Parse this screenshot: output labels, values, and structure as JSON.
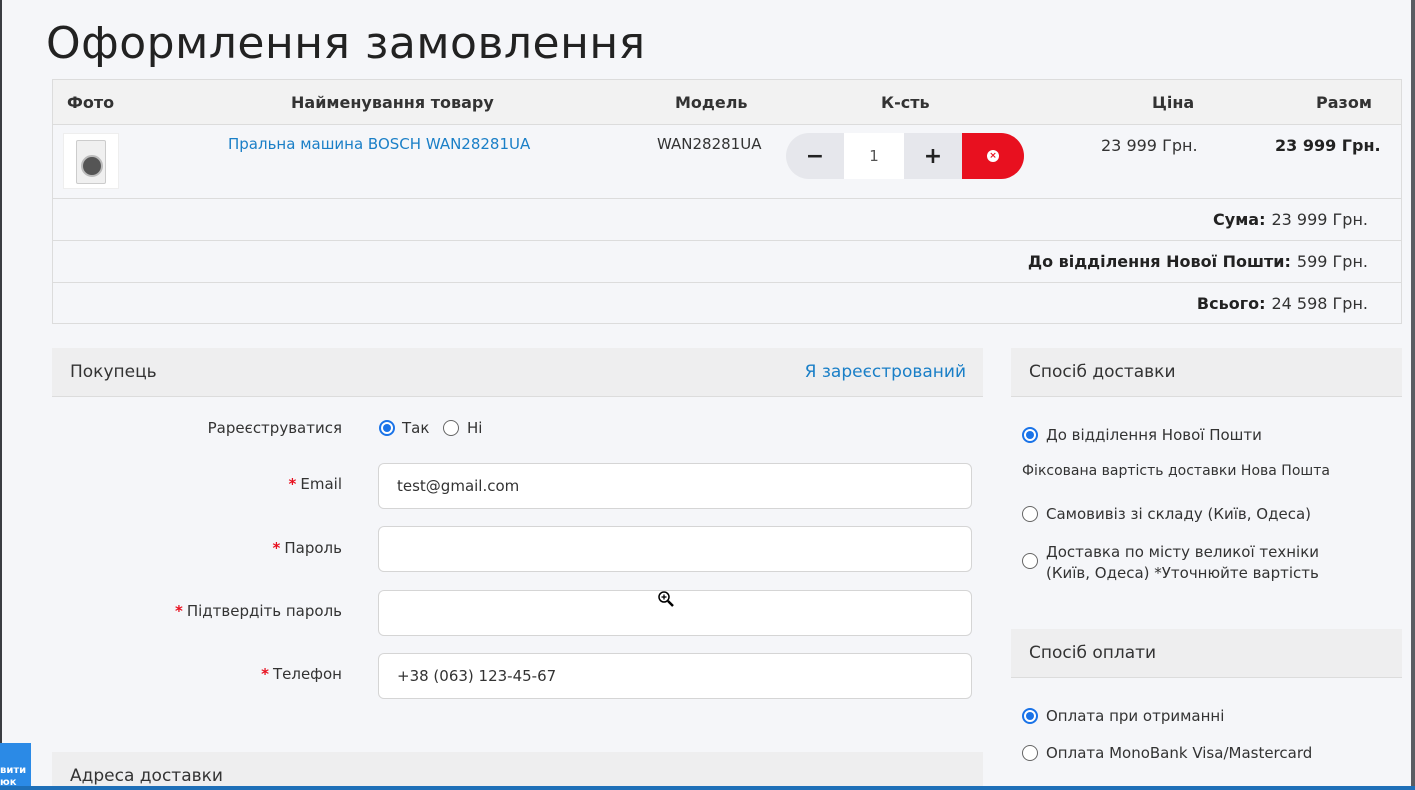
{
  "page_title": "Оформлення замовлення",
  "cart": {
    "headers": [
      "Фото",
      "Найменування товару",
      "Модель",
      "К-сть",
      "Ціна",
      "Разом"
    ],
    "item": {
      "name": "Пральна машина BOSCH WAN28281UA",
      "model": "WAN28281UA",
      "quantity": "1",
      "price": "23 999 Грн.",
      "total": "23 999 Грн.",
      "minus": "−",
      "plus": "+",
      "remove": "×"
    },
    "totals": [
      {
        "label": "Сума:",
        "value": "23 999 Грн."
      },
      {
        "label": "До відділення Нової Пошти:",
        "value": "599 Грн."
      },
      {
        "label": "Всього:",
        "value": "24 598 Грн."
      }
    ]
  },
  "buyer": {
    "title": "Покупець",
    "login_link": "Я зареєстрований",
    "register_label": "Рареєструватися",
    "register_yes": "Так",
    "register_no": "Ні",
    "email_label": "Email",
    "email_value": "test@gmail.com",
    "password_label": "Пароль",
    "password_value": "",
    "confirm_label": "Підтвердіть пароль",
    "confirm_value": "",
    "phone_label": "Телефон",
    "phone_value": "+38 (063) 123-45-67",
    "required_mark": "*"
  },
  "address": {
    "title": "Адреса доставки"
  },
  "delivery": {
    "title": "Спосіб доставки",
    "options": [
      "До відділення Нової Пошти",
      "Самовивіз зі складу (Київ, Одеса)",
      "Доставка по місту великої техніки (Київ, Одеса) *Уточнюйте вартість"
    ],
    "selected": 0,
    "note": "Фіксована вартість доставки Нова Пошта"
  },
  "payment": {
    "title": "Спосіб оплати",
    "options": [
      "Оплата при отриманні",
      "Оплата MonoBank Visa/Mastercard"
    ],
    "selected": 0
  },
  "side_tab": "вити\nюк",
  "colors": {
    "accent": "#1a73e8",
    "link": "#1a7fc7",
    "remove": "#e8101f",
    "callback_tab": "#2b8ae6"
  }
}
